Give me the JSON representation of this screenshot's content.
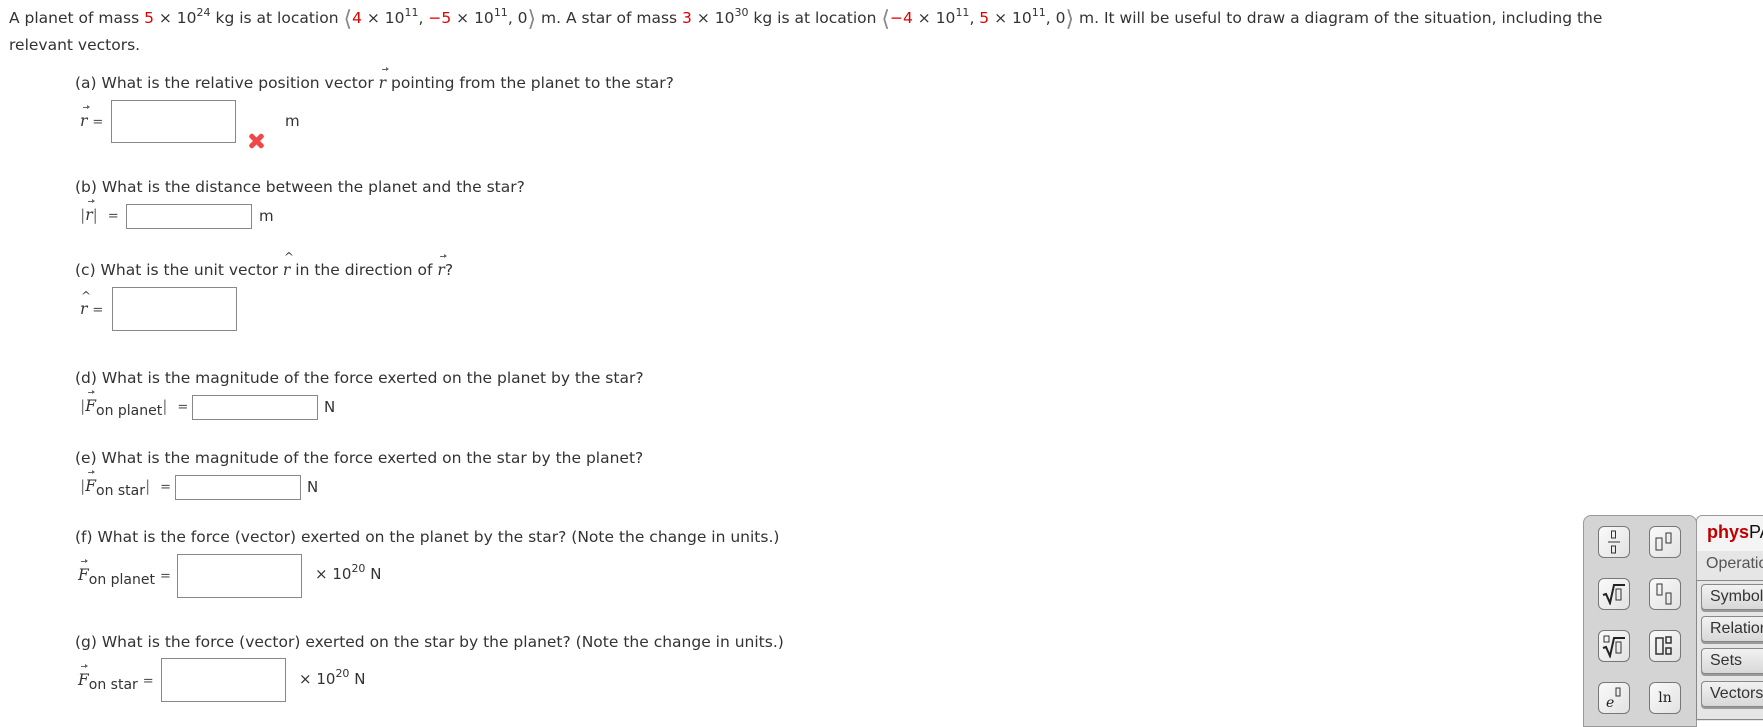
{
  "problem": {
    "intro_p1": "A planet of mass ",
    "planet_mass_coef": "5",
    "planet_mass_rest": " × 10",
    "planet_mass_exp": "24",
    "planet_mass_unit": " kg is at location ",
    "planet_x_coef": "4",
    "planet_x_rest": " × 10",
    "planet_x_exp": "11",
    "sep1": ", ",
    "planet_y_coef": "−5",
    "planet_y_rest": " × 10",
    "planet_y_exp": "11",
    "planet_z": ", 0",
    "loc_unit1": " m.  A star of mass ",
    "star_mass_coef": "3",
    "star_mass_rest": " × 10",
    "star_mass_exp": "30",
    "star_mass_unit": " kg is at location ",
    "star_x_coef": "−4",
    "star_x_rest": " × 10",
    "star_x_exp": "11",
    "sep2": ", ",
    "star_y_coef": "5",
    "star_y_rest": " × 10",
    "star_y_exp": "11",
    "star_z": ", 0",
    "tail": " m.  It will be useful to draw a diagram of the situation, including the",
    "line2": "relevant vectors.",
    "angle_open": "⟨",
    "angle_close": "⟩",
    "highlight_color": "#e00000"
  },
  "parts": {
    "a": {
      "question_pre": "(a) What is the relative position vector ",
      "symbol": "r",
      "question_post": " pointing from the planet to the star?",
      "label": "r",
      "eq": "=",
      "value": "",
      "unit": "m",
      "status": "incorrect"
    },
    "b": {
      "question": "(b) What is the distance between the planet and the star?",
      "label_open": "|",
      "symbol": "r",
      "label_close": "|",
      "eq": "=",
      "value": "",
      "unit": "m"
    },
    "c": {
      "question_pre": "(c) What is the unit vector ",
      "hat_symbol": "r",
      "question_mid": " in the direction of ",
      "vec_symbol": "r",
      "question_post": "?",
      "label": "r",
      "eq": "=",
      "value": ""
    },
    "d": {
      "question": "(d) What is the magnitude of the force exerted on the planet by the star?",
      "label_open": "|",
      "symbol": "F",
      "subscript": "on planet",
      "label_close": "|",
      "eq": "=",
      "value": "",
      "unit": "N"
    },
    "e": {
      "question": "(e) What is the magnitude of the force exerted on the star by the planet?",
      "label_open": "|",
      "symbol": "F",
      "subscript": "on star",
      "label_close": "|",
      "eq": "=",
      "value": "",
      "unit": "N"
    },
    "f": {
      "question": "(f) What is the force (vector) exerted on the planet by the star? (Note the change in units.)",
      "symbol": "F",
      "subscript": "on planet",
      "eq": "=",
      "value": "",
      "unit_pre": "× 10",
      "unit_exp": "20",
      "unit_post": " N"
    },
    "g": {
      "question": "(g) What is the force (vector) exerted on the star by the planet? (Note the change in units.)",
      "symbol": "F",
      "subscript": "on star",
      "eq": "=",
      "value": "",
      "unit_pre": "× 10",
      "unit_exp": "20",
      "unit_post": " N"
    }
  },
  "palette": {
    "buttons": [
      {
        "name": "fraction",
        "glyph": "▯⁄▯"
      },
      {
        "name": "superscript",
        "glyph": "▯▯"
      },
      {
        "name": "square-root",
        "glyph": "√▯"
      },
      {
        "name": "subscript",
        "glyph": "▯▯"
      },
      {
        "name": "nth-root",
        "glyph": "∜▯"
      },
      {
        "name": "sub-superscript",
        "glyph": "▯▯"
      },
      {
        "name": "exponential",
        "glyph": "e▯"
      },
      {
        "name": "natural-log",
        "glyph": "ln"
      }
    ],
    "tab_brand": "phys",
    "tab_rest": "PAD",
    "operations_label": "Operations",
    "categories": [
      "Symbols",
      "Relations",
      "Sets",
      "Vectors"
    ]
  }
}
